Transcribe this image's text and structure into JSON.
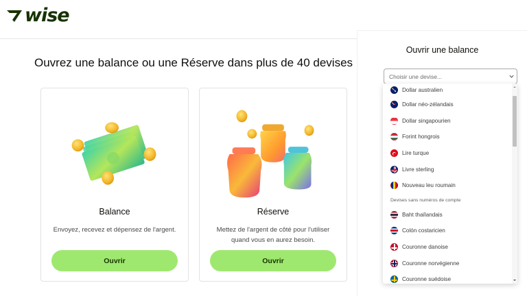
{
  "brand": {
    "name": "wise",
    "color": "#163300",
    "accent": "#9fe870"
  },
  "headline": "Ouvrez une balance ou une Réserve dans plus de 40 devises",
  "cards": [
    {
      "title": "Balance",
      "description": "Envoyez, recevez et dépensez de l'argent.",
      "button": "Ouvrir",
      "illustration": "money-bills-coins"
    },
    {
      "title": "Réserve",
      "description": "Mettez de l'argent de côté pour l'utiliser quand vous en aurez besoin.",
      "button": "Ouvrir",
      "illustration": "colorful-jars-coins"
    }
  ],
  "side_panel": {
    "title": "Ouvrir une balance",
    "select_placeholder": "Choisir une devise..."
  },
  "dropdown": {
    "items": [
      {
        "label": "Dollar australien",
        "flag": "australia-flag-icon"
      },
      {
        "label": "Dollar néo-zélandais",
        "flag": "new-zealand-flag-icon"
      },
      {
        "label": "Dollar singapourien",
        "flag": "singapore-flag-icon"
      },
      {
        "label": "Forint hongrois",
        "flag": "hungary-flag-icon"
      },
      {
        "label": "Lire turque",
        "flag": "turkey-flag-icon"
      },
      {
        "label": "Livre sterling",
        "flag": "uk-flag-icon"
      },
      {
        "label": "Nouveau leu roumain",
        "flag": "romania-flag-icon"
      }
    ],
    "section_label": "Devises sans numéros de compte",
    "items2": [
      {
        "label": "Baht thaïlandais",
        "flag": "thailand-flag-icon"
      },
      {
        "label": "Colón costaricien",
        "flag": "costa-rica-flag-icon"
      },
      {
        "label": "Couronne danoise",
        "flag": "denmark-flag-icon"
      },
      {
        "label": "Couronne norvégienne",
        "flag": "norway-flag-icon"
      },
      {
        "label": "Couronne suédoise",
        "flag": "sweden-flag-icon"
      }
    ]
  }
}
